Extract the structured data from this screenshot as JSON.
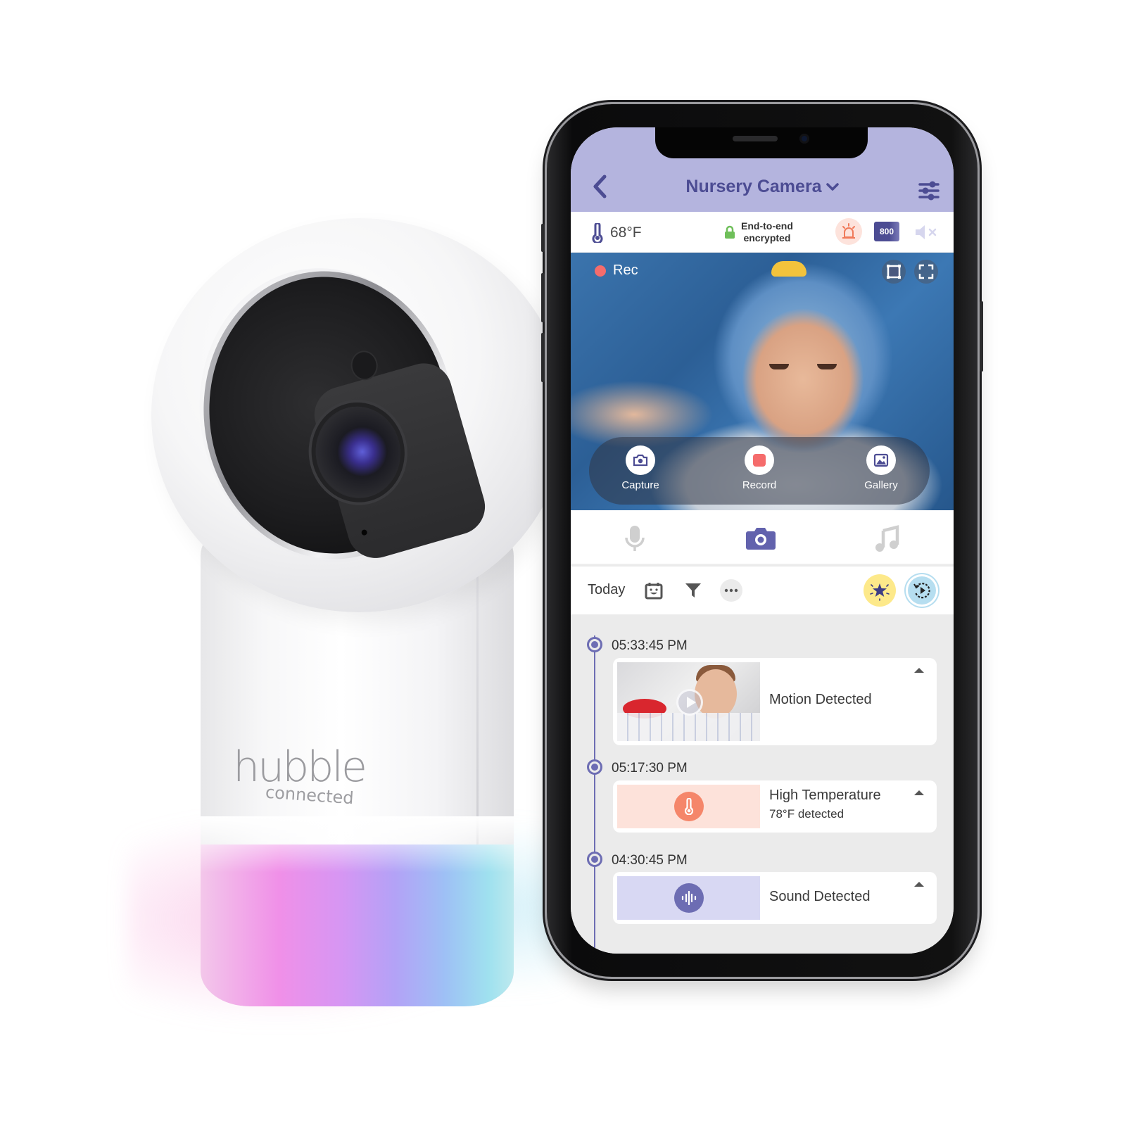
{
  "product": {
    "brand_name": "hubble",
    "brand_sub": "connected",
    "light_colors": [
      "#f090e8",
      "#d696f3",
      "#b3a2f6",
      "#9ec0f5",
      "#9fe1ef"
    ]
  },
  "app": {
    "header": {
      "title": "Nursery Camera",
      "back_icon": "chevron-left-icon",
      "title_dropdown_icon": "chevron-down-icon",
      "settings_icon": "sliders-icon",
      "bg_color": "#b4b4de",
      "accent_color": "#4c4c93"
    },
    "status": {
      "temperature": "68°F",
      "encryption_line1": "End-to-end",
      "encryption_line2": "encrypted",
      "night_vision_label": "800",
      "alarm_icon": "siren-icon",
      "mute_icon": "speaker-muted-icon"
    },
    "video": {
      "rec_label": "Rec",
      "rec_color": "#f56c6c",
      "actions": [
        {
          "label": "Capture",
          "icon": "camera-icon"
        },
        {
          "label": "Record",
          "icon": "record-icon"
        },
        {
          "label": "Gallery",
          "icon": "gallery-icon"
        }
      ]
    },
    "modes": [
      {
        "name": "talk",
        "icon": "microphone-icon",
        "active": false
      },
      {
        "name": "camera",
        "icon": "camera-icon",
        "active": true
      },
      {
        "name": "music",
        "icon": "music-note-icon",
        "active": false
      }
    ],
    "filter": {
      "date_label": "Today",
      "calendar_icon": "calendar-icon",
      "filter_icon": "funnel-icon",
      "more_icon": "more-horizontal-icon",
      "highlights_icon": "star-burst-icon",
      "replay_icon": "replay-icon"
    },
    "events": [
      {
        "time": "05:33:45 PM",
        "title": "Motion Detected",
        "subtitle": "",
        "type": "motion"
      },
      {
        "time": "05:17:30 PM",
        "title": "High Temperature",
        "subtitle": "78°F  detected",
        "type": "temperature",
        "color": "#f5866a"
      },
      {
        "time": "04:30:45 PM",
        "title": "Sound Detected",
        "subtitle": "",
        "type": "sound",
        "color": "#6d6db3"
      }
    ]
  }
}
